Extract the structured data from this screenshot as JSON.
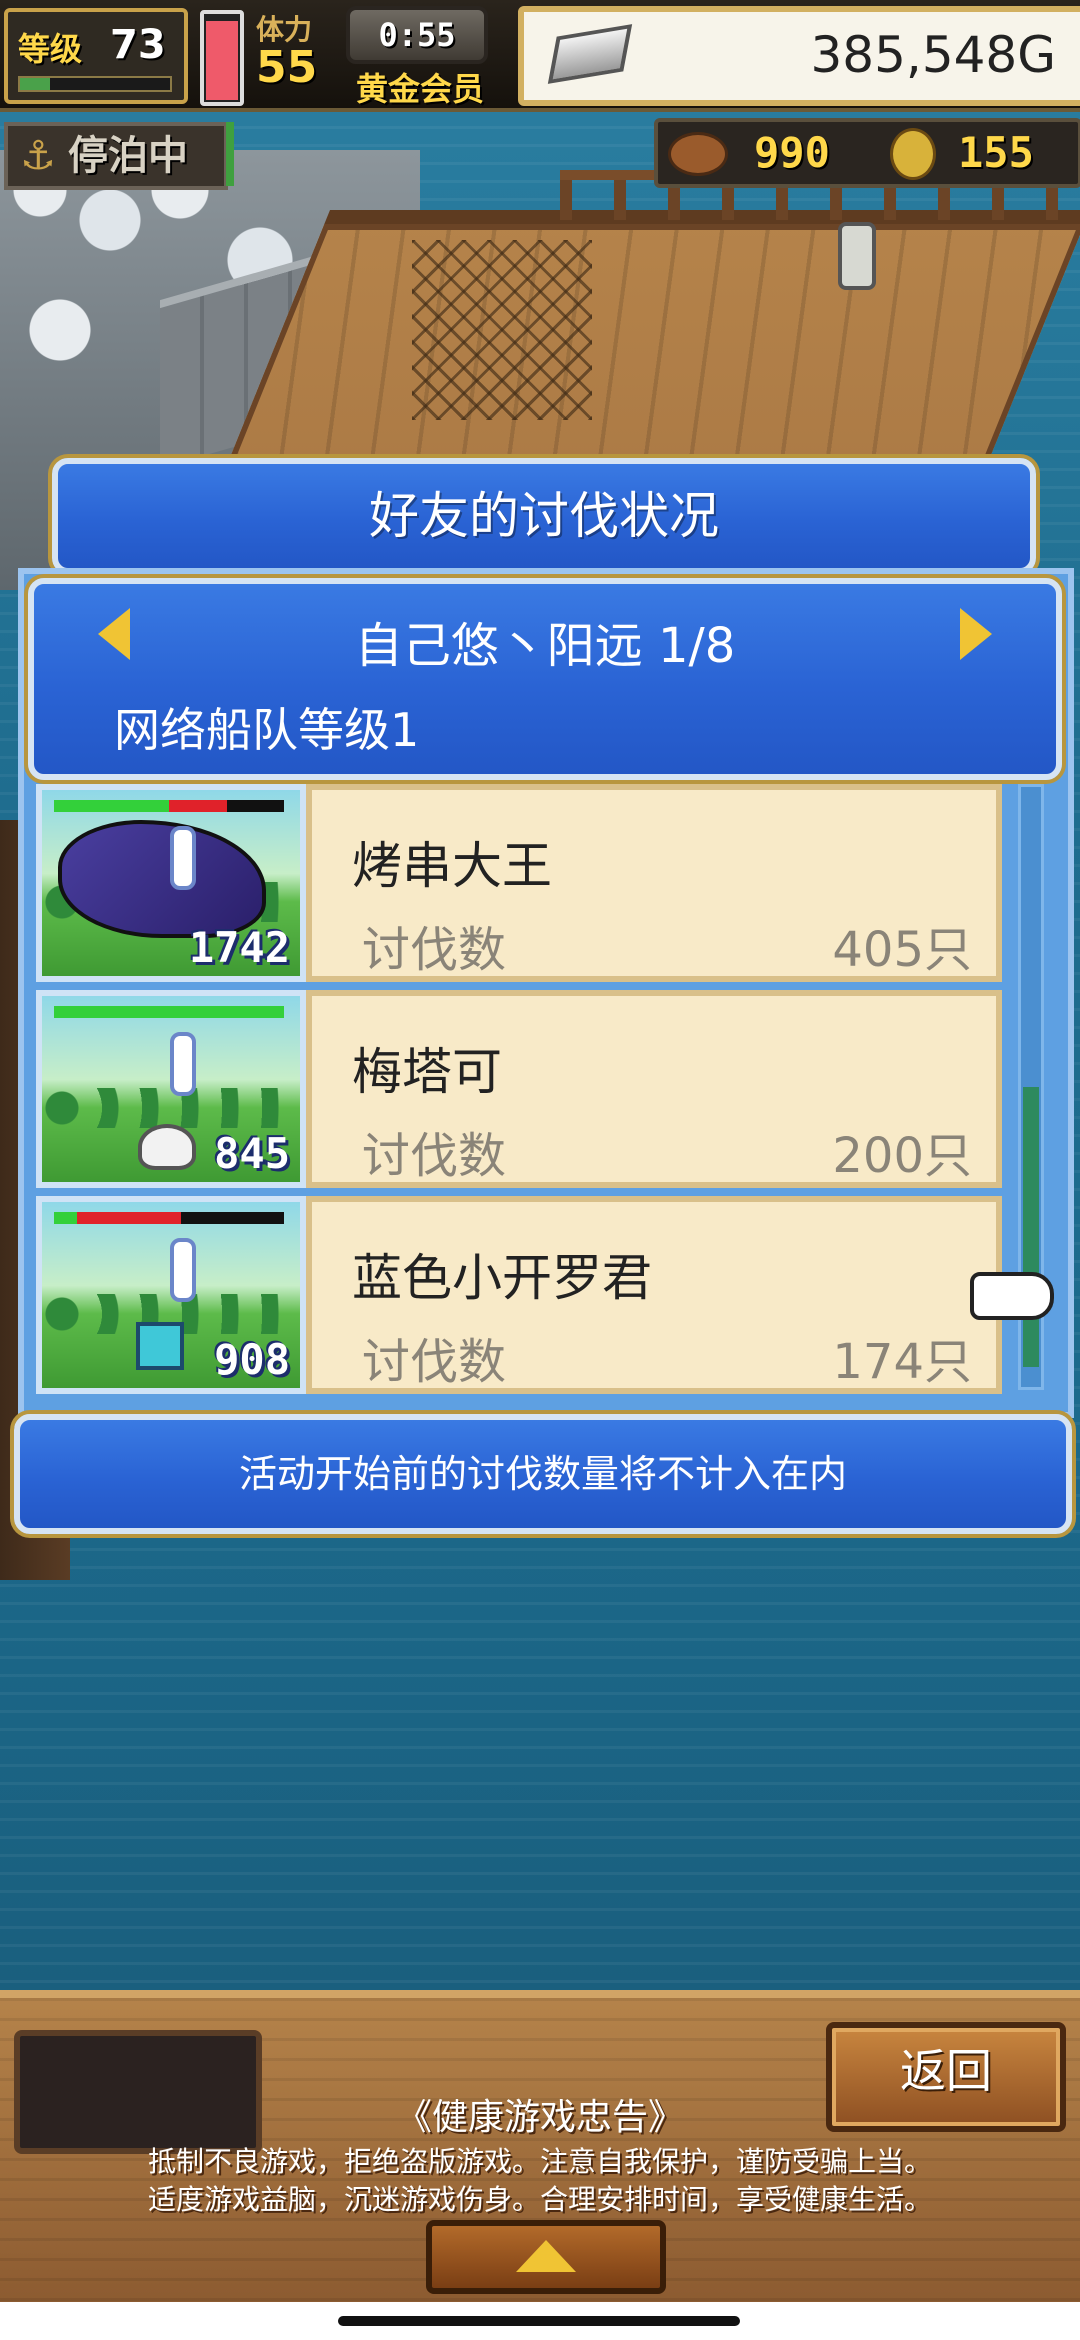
{
  "hud": {
    "level_label": "等级",
    "level_value": "73",
    "level_progress": 0.2,
    "stamina_label": "体力",
    "stamina_value": "55",
    "stamina_fill": 0.9,
    "timer": "0:55",
    "membership": "黄金会员",
    "money": "385,548G",
    "dock_status": "停泊中",
    "food": "990",
    "medals": "155"
  },
  "dialog": {
    "title": "好友的讨伐状况",
    "friend_name": "自己悠丶阳远 1/8",
    "fleet_level": "网络船队等级1",
    "footer_note": "活动开始前的讨伐数量将不计入在内"
  },
  "monsters": [
    {
      "name": "烤串大王",
      "label": "讨伐数",
      "count": "405只",
      "level": "1742",
      "hp_green": 0.5,
      "hp_red": 0.25
    },
    {
      "name": "梅塔可",
      "label": "讨伐数",
      "count": "200只",
      "level": "845",
      "hp_green": 1.0,
      "hp_red": 0
    },
    {
      "name": "蓝色小开罗君",
      "label": "讨伐数",
      "count": "174只",
      "level": "908",
      "hp_green": 0.1,
      "hp_red": 0.45
    }
  ],
  "bottom": {
    "back_label": "返回",
    "health_title": "《健康游戏忠告》",
    "health_line1": "抵制不良游戏，拒绝盗版游戏。注意自我保护，谨防受骗上当。",
    "health_line2": "适度游戏益脑，沉迷游戏伤身。合理安排时间，享受健康生活。"
  },
  "icons": {
    "anchor": "anchor-icon",
    "silver": "silver-bar-icon",
    "food": "bread-icon",
    "medal": "coin-icon"
  },
  "colors": {
    "panel_blue": "#2a63d4",
    "card_bg": "#f8eac8",
    "gold": "#ffd84a"
  }
}
